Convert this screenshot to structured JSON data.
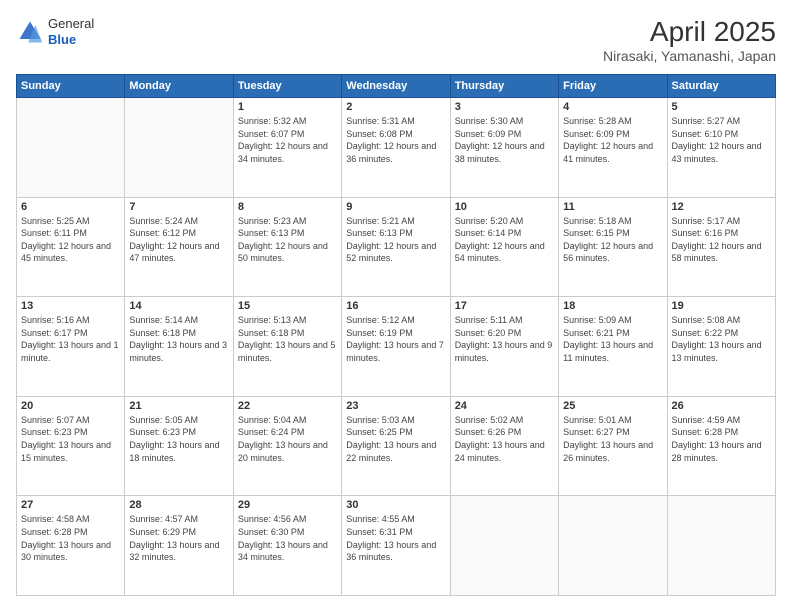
{
  "logo": {
    "line1": "General",
    "line2": "Blue"
  },
  "title": "April 2025",
  "subtitle": "Nirasaki, Yamanashi, Japan",
  "weekdays": [
    "Sunday",
    "Monday",
    "Tuesday",
    "Wednesday",
    "Thursday",
    "Friday",
    "Saturday"
  ],
  "weeks": [
    [
      {
        "day": "",
        "sunrise": "",
        "sunset": "",
        "daylight": ""
      },
      {
        "day": "",
        "sunrise": "",
        "sunset": "",
        "daylight": ""
      },
      {
        "day": "1",
        "sunrise": "Sunrise: 5:32 AM",
        "sunset": "Sunset: 6:07 PM",
        "daylight": "Daylight: 12 hours and 34 minutes."
      },
      {
        "day": "2",
        "sunrise": "Sunrise: 5:31 AM",
        "sunset": "Sunset: 6:08 PM",
        "daylight": "Daylight: 12 hours and 36 minutes."
      },
      {
        "day": "3",
        "sunrise": "Sunrise: 5:30 AM",
        "sunset": "Sunset: 6:09 PM",
        "daylight": "Daylight: 12 hours and 38 minutes."
      },
      {
        "day": "4",
        "sunrise": "Sunrise: 5:28 AM",
        "sunset": "Sunset: 6:09 PM",
        "daylight": "Daylight: 12 hours and 41 minutes."
      },
      {
        "day": "5",
        "sunrise": "Sunrise: 5:27 AM",
        "sunset": "Sunset: 6:10 PM",
        "daylight": "Daylight: 12 hours and 43 minutes."
      }
    ],
    [
      {
        "day": "6",
        "sunrise": "Sunrise: 5:25 AM",
        "sunset": "Sunset: 6:11 PM",
        "daylight": "Daylight: 12 hours and 45 minutes."
      },
      {
        "day": "7",
        "sunrise": "Sunrise: 5:24 AM",
        "sunset": "Sunset: 6:12 PM",
        "daylight": "Daylight: 12 hours and 47 minutes."
      },
      {
        "day": "8",
        "sunrise": "Sunrise: 5:23 AM",
        "sunset": "Sunset: 6:13 PM",
        "daylight": "Daylight: 12 hours and 50 minutes."
      },
      {
        "day": "9",
        "sunrise": "Sunrise: 5:21 AM",
        "sunset": "Sunset: 6:13 PM",
        "daylight": "Daylight: 12 hours and 52 minutes."
      },
      {
        "day": "10",
        "sunrise": "Sunrise: 5:20 AM",
        "sunset": "Sunset: 6:14 PM",
        "daylight": "Daylight: 12 hours and 54 minutes."
      },
      {
        "day": "11",
        "sunrise": "Sunrise: 5:18 AM",
        "sunset": "Sunset: 6:15 PM",
        "daylight": "Daylight: 12 hours and 56 minutes."
      },
      {
        "day": "12",
        "sunrise": "Sunrise: 5:17 AM",
        "sunset": "Sunset: 6:16 PM",
        "daylight": "Daylight: 12 hours and 58 minutes."
      }
    ],
    [
      {
        "day": "13",
        "sunrise": "Sunrise: 5:16 AM",
        "sunset": "Sunset: 6:17 PM",
        "daylight": "Daylight: 13 hours and 1 minute."
      },
      {
        "day": "14",
        "sunrise": "Sunrise: 5:14 AM",
        "sunset": "Sunset: 6:18 PM",
        "daylight": "Daylight: 13 hours and 3 minutes."
      },
      {
        "day": "15",
        "sunrise": "Sunrise: 5:13 AM",
        "sunset": "Sunset: 6:18 PM",
        "daylight": "Daylight: 13 hours and 5 minutes."
      },
      {
        "day": "16",
        "sunrise": "Sunrise: 5:12 AM",
        "sunset": "Sunset: 6:19 PM",
        "daylight": "Daylight: 13 hours and 7 minutes."
      },
      {
        "day": "17",
        "sunrise": "Sunrise: 5:11 AM",
        "sunset": "Sunset: 6:20 PM",
        "daylight": "Daylight: 13 hours and 9 minutes."
      },
      {
        "day": "18",
        "sunrise": "Sunrise: 5:09 AM",
        "sunset": "Sunset: 6:21 PM",
        "daylight": "Daylight: 13 hours and 11 minutes."
      },
      {
        "day": "19",
        "sunrise": "Sunrise: 5:08 AM",
        "sunset": "Sunset: 6:22 PM",
        "daylight": "Daylight: 13 hours and 13 minutes."
      }
    ],
    [
      {
        "day": "20",
        "sunrise": "Sunrise: 5:07 AM",
        "sunset": "Sunset: 6:23 PM",
        "daylight": "Daylight: 13 hours and 15 minutes."
      },
      {
        "day": "21",
        "sunrise": "Sunrise: 5:05 AM",
        "sunset": "Sunset: 6:23 PM",
        "daylight": "Daylight: 13 hours and 18 minutes."
      },
      {
        "day": "22",
        "sunrise": "Sunrise: 5:04 AM",
        "sunset": "Sunset: 6:24 PM",
        "daylight": "Daylight: 13 hours and 20 minutes."
      },
      {
        "day": "23",
        "sunrise": "Sunrise: 5:03 AM",
        "sunset": "Sunset: 6:25 PM",
        "daylight": "Daylight: 13 hours and 22 minutes."
      },
      {
        "day": "24",
        "sunrise": "Sunrise: 5:02 AM",
        "sunset": "Sunset: 6:26 PM",
        "daylight": "Daylight: 13 hours and 24 minutes."
      },
      {
        "day": "25",
        "sunrise": "Sunrise: 5:01 AM",
        "sunset": "Sunset: 6:27 PM",
        "daylight": "Daylight: 13 hours and 26 minutes."
      },
      {
        "day": "26",
        "sunrise": "Sunrise: 4:59 AM",
        "sunset": "Sunset: 6:28 PM",
        "daylight": "Daylight: 13 hours and 28 minutes."
      }
    ],
    [
      {
        "day": "27",
        "sunrise": "Sunrise: 4:58 AM",
        "sunset": "Sunset: 6:28 PM",
        "daylight": "Daylight: 13 hours and 30 minutes."
      },
      {
        "day": "28",
        "sunrise": "Sunrise: 4:57 AM",
        "sunset": "Sunset: 6:29 PM",
        "daylight": "Daylight: 13 hours and 32 minutes."
      },
      {
        "day": "29",
        "sunrise": "Sunrise: 4:56 AM",
        "sunset": "Sunset: 6:30 PM",
        "daylight": "Daylight: 13 hours and 34 minutes."
      },
      {
        "day": "30",
        "sunrise": "Sunrise: 4:55 AM",
        "sunset": "Sunset: 6:31 PM",
        "daylight": "Daylight: 13 hours and 36 minutes."
      },
      {
        "day": "",
        "sunrise": "",
        "sunset": "",
        "daylight": ""
      },
      {
        "day": "",
        "sunrise": "",
        "sunset": "",
        "daylight": ""
      },
      {
        "day": "",
        "sunrise": "",
        "sunset": "",
        "daylight": ""
      }
    ]
  ]
}
